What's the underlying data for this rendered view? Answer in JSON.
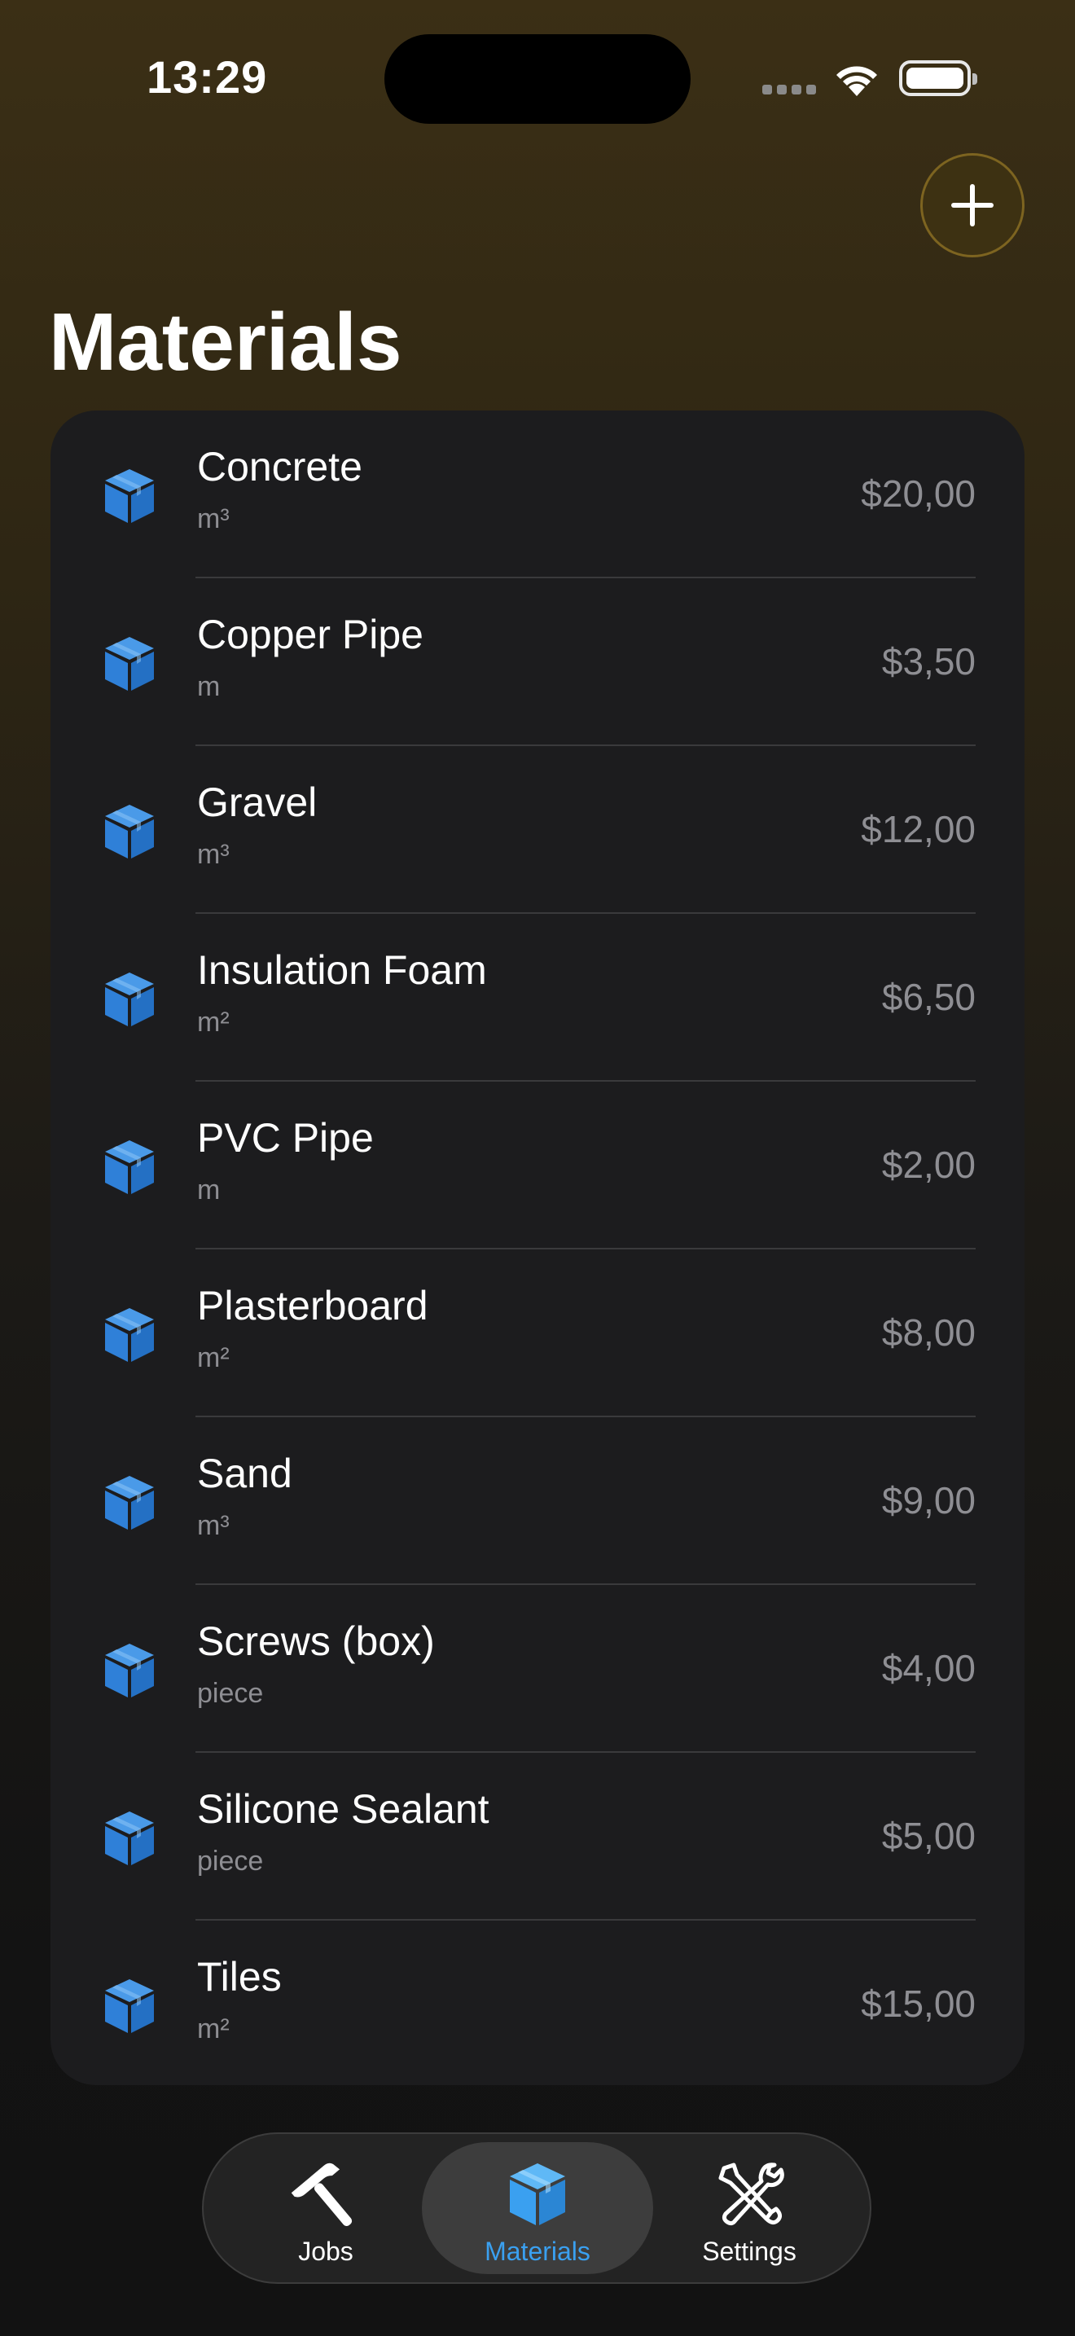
{
  "status_bar": {
    "time": "13:29"
  },
  "header": {
    "title": "Materials",
    "add_icon": "plus-icon"
  },
  "accent_color": "#3aa0f0",
  "materials": [
    {
      "name": "Concrete",
      "unit": "m³",
      "price": "$20,00"
    },
    {
      "name": "Copper Pipe",
      "unit": "m",
      "price": "$3,50"
    },
    {
      "name": "Gravel",
      "unit": "m³",
      "price": "$12,00"
    },
    {
      "name": "Insulation Foam",
      "unit": "m²",
      "price": "$6,50"
    },
    {
      "name": "PVC Pipe",
      "unit": "m",
      "price": "$2,00"
    },
    {
      "name": "Plasterboard",
      "unit": "m²",
      "price": "$8,00"
    },
    {
      "name": "Sand",
      "unit": "m³",
      "price": "$9,00"
    },
    {
      "name": "Screws (box)",
      "unit": "piece",
      "price": "$4,00"
    },
    {
      "name": "Silicone Sealant",
      "unit": "piece",
      "price": "$5,00"
    },
    {
      "name": "Tiles",
      "unit": "m²",
      "price": "$15,00"
    }
  ],
  "tab_bar": {
    "tabs": [
      {
        "label": "Jobs",
        "icon": "hammer-icon",
        "active": false
      },
      {
        "label": "Materials",
        "icon": "cube-icon",
        "active": true
      },
      {
        "label": "Settings",
        "icon": "tools-icon",
        "active": false
      }
    ]
  }
}
